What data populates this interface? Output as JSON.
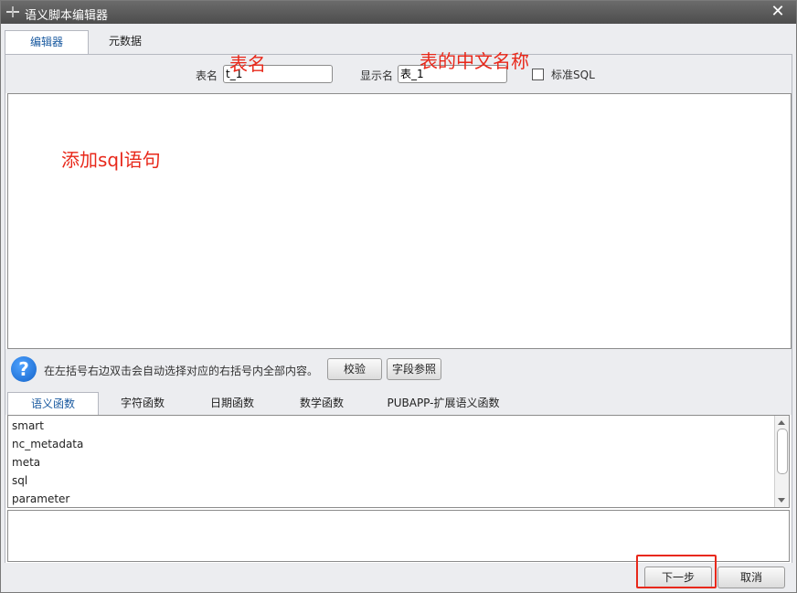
{
  "window": {
    "title": "语义脚本编辑器",
    "close_glyph": "✕"
  },
  "tabs_top": [
    {
      "label": "编辑器"
    },
    {
      "label": "元数据"
    }
  ],
  "form": {
    "table_name_label": "表名",
    "table_name_value": "t_1",
    "display_name_label": "显示名",
    "display_name_value": "表_1",
    "standard_sql_label": "标准SQL"
  },
  "annotations": {
    "table_name": "表名",
    "chinese_name": "表的中文名称",
    "add_sql": "添加sql语句"
  },
  "hint": {
    "text": "在左括号右边双击会自动选择对应的右括号内全部内容。",
    "verify_button": "校验",
    "field_ref_button": "字段参照"
  },
  "function_tabs": [
    {
      "label": "语义函数"
    },
    {
      "label": "字符函数"
    },
    {
      "label": "日期函数"
    },
    {
      "label": "数学函数"
    },
    {
      "label": "PUBAPP-扩展语义函数"
    }
  ],
  "function_list": [
    "smart",
    "nc_metadata",
    "meta",
    "sql",
    "parameter"
  ],
  "footer": {
    "next_button": "下一步",
    "cancel_button": "取消"
  },
  "colors": {
    "annotation": "#e8281a",
    "active_tab_text": "#1a5aa0",
    "titlebar": "#555555"
  }
}
